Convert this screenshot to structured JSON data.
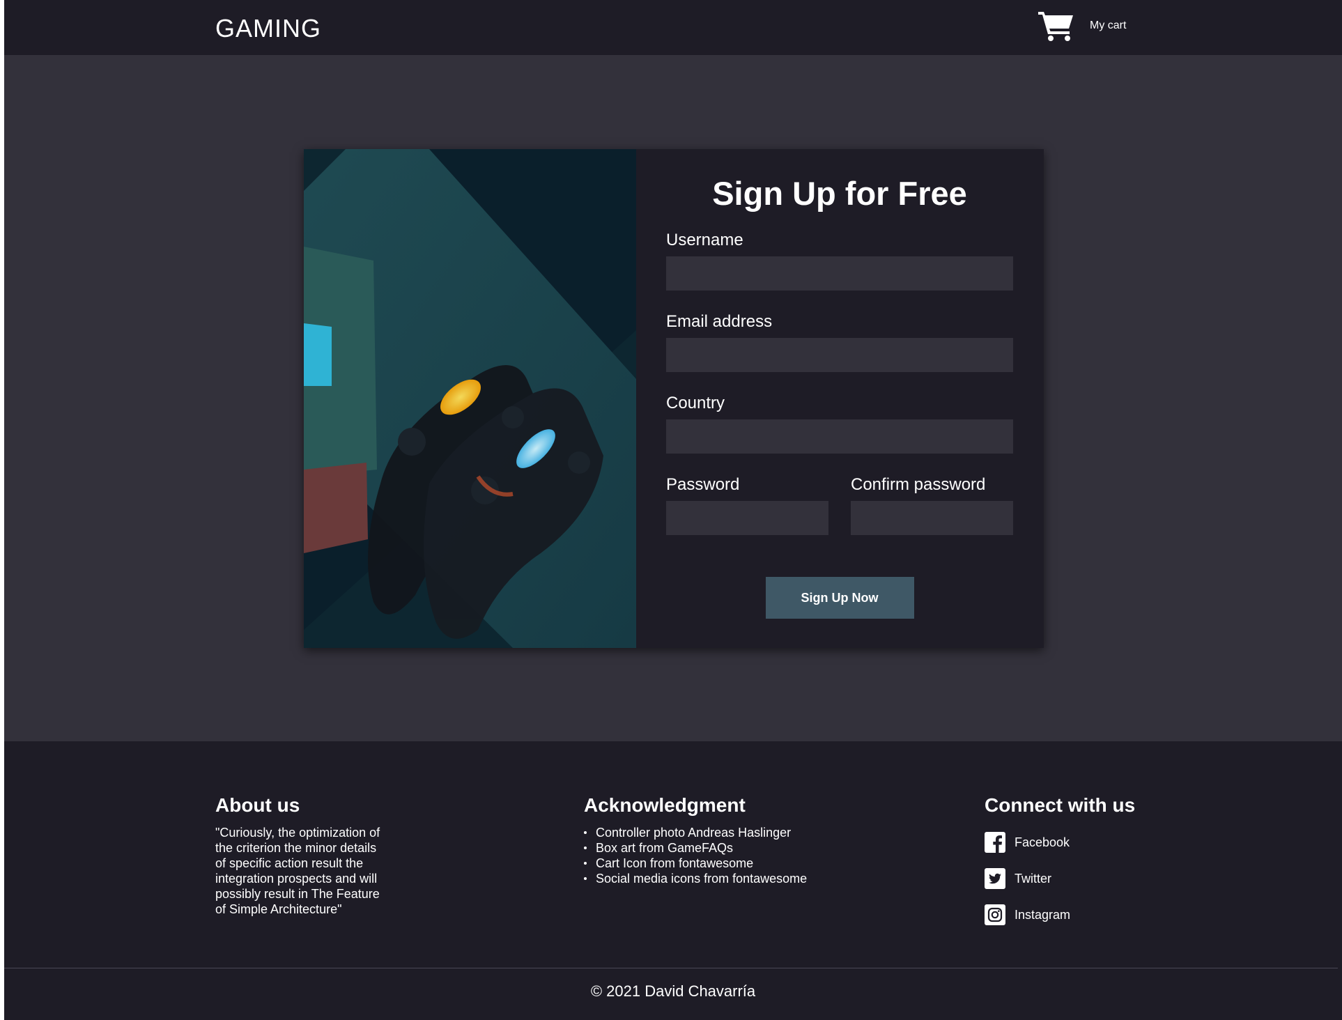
{
  "header": {
    "brand": "GAMING",
    "cart_label": "My cart"
  },
  "signup": {
    "title": "Sign Up for Free",
    "username_label": "Username",
    "username_value": "",
    "email_label": "Email address",
    "email_value": "",
    "country_label": "Country",
    "country_value": "",
    "password_label": "Password",
    "password_value": "",
    "confirm_label": "Confirm password",
    "confirm_value": "",
    "submit_label": "Sign Up Now"
  },
  "footer": {
    "about": {
      "heading": "About us",
      "text": "\"Curiously, the optimization of the criterion the minor details of specific action result the integration prospects and will possibly result in The Feature of Simple Architecture\""
    },
    "acknowledgment": {
      "heading": "Acknowledgment",
      "items": [
        "Controller photo Andreas Haslinger",
        "Box art from GameFAQs",
        "Cart Icon from fontawesome",
        "Social media icons from fontawesome"
      ]
    },
    "connect": {
      "heading": "Connect with us",
      "links": [
        {
          "label": "Facebook",
          "icon": "facebook-icon"
        },
        {
          "label": "Twitter",
          "icon": "twitter-icon"
        },
        {
          "label": "Instagram",
          "icon": "instagram-icon"
        }
      ]
    },
    "copyright": "© 2021 David Chavarría"
  },
  "colors": {
    "page_bg": "#33313b",
    "panel_bg": "#1e1c26",
    "input_bg": "#33313b",
    "button_bg": "#3f5866"
  }
}
